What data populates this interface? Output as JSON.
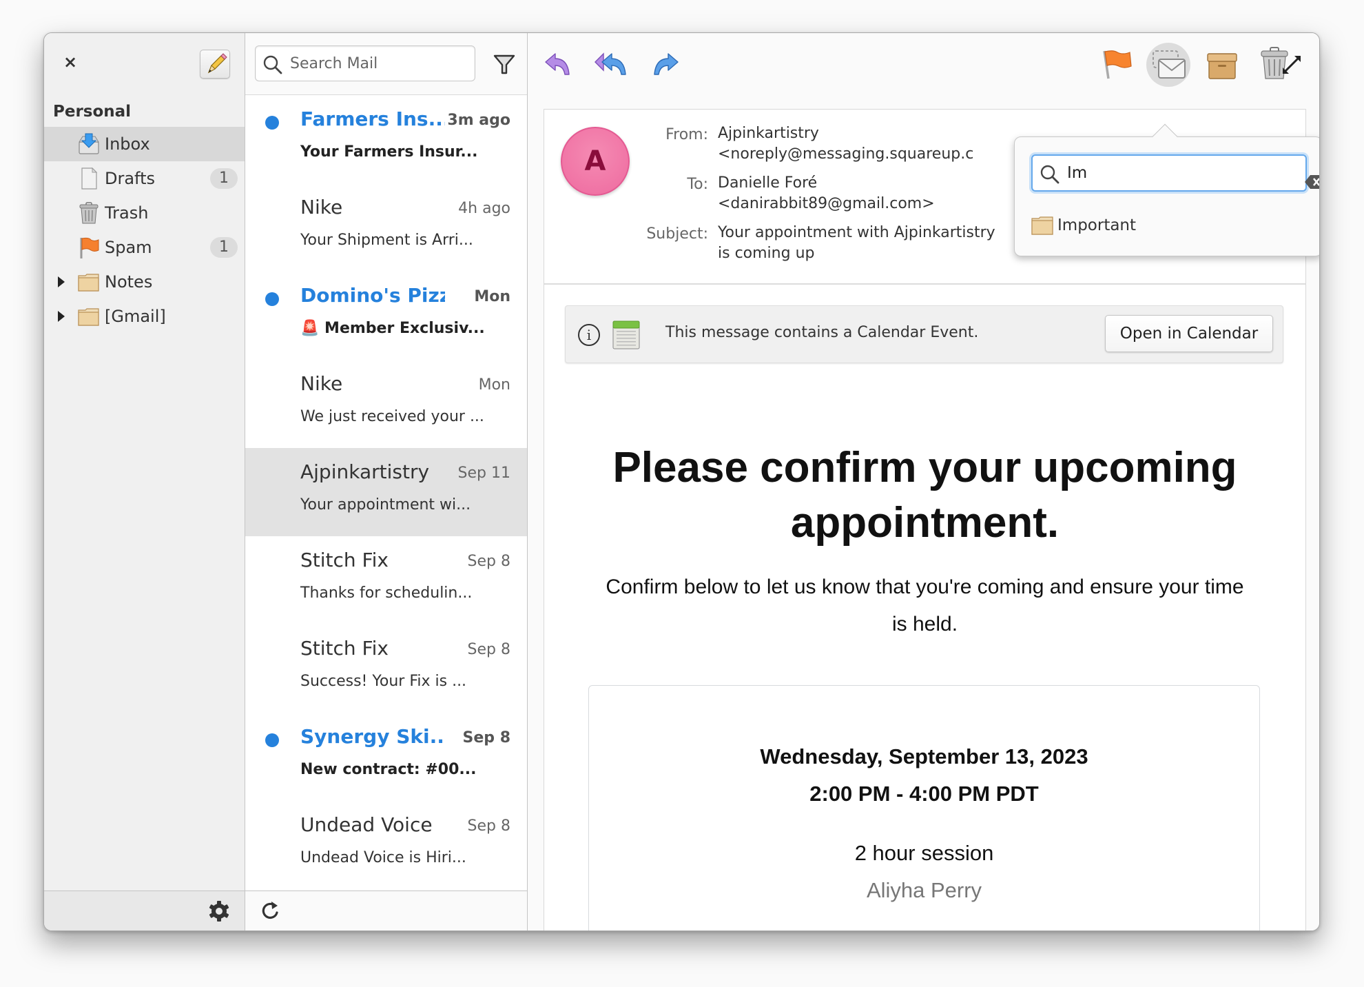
{
  "sidebar": {
    "close_label": "×",
    "account": "Personal",
    "folders": [
      {
        "label": "Inbox",
        "icon": "inbox-icon",
        "badge": null,
        "selected": true,
        "expandable": false
      },
      {
        "label": "Drafts",
        "icon": "drafts-icon",
        "badge": "1",
        "selected": false,
        "expandable": false
      },
      {
        "label": "Trash",
        "icon": "trash-icon",
        "badge": null,
        "selected": false,
        "expandable": false
      },
      {
        "label": "Spam",
        "icon": "flag-icon",
        "badge": "1",
        "selected": false,
        "expandable": false
      },
      {
        "label": "Notes",
        "icon": "folder-icon",
        "badge": null,
        "selected": false,
        "expandable": true
      },
      {
        "label": "[Gmail]",
        "icon": "folder-icon",
        "badge": null,
        "selected": false,
        "expandable": true
      }
    ]
  },
  "message_list": {
    "search_placeholder": "Search Mail",
    "messages": [
      {
        "sender": "Farmers Ins...",
        "date": "3m ago",
        "subject": "Your Farmers Insur...",
        "unread": true,
        "selected": false
      },
      {
        "sender": "Nike",
        "date": "4h ago",
        "subject": "Your Shipment is Arri...",
        "unread": false,
        "selected": false
      },
      {
        "sender": "Domino's Pizza",
        "date": "Mon",
        "subject": "🚨 Member Exclusiv...",
        "unread": true,
        "selected": false
      },
      {
        "sender": "Nike",
        "date": "Mon",
        "subject": "We just received your ...",
        "unread": false,
        "selected": false
      },
      {
        "sender": "Ajpinkartistry",
        "date": "Sep 11",
        "subject": "Your appointment wi...",
        "unread": false,
        "selected": true
      },
      {
        "sender": "Stitch Fix",
        "date": "Sep  8",
        "subject": "Thanks for schedulin...",
        "unread": false,
        "selected": false
      },
      {
        "sender": "Stitch Fix",
        "date": "Sep  8",
        "subject": "Success! Your Fix is ...",
        "unread": false,
        "selected": false
      },
      {
        "sender": "Synergy Ski...",
        "date": "Sep  8",
        "subject": "New contract: #00...",
        "unread": true,
        "selected": false
      },
      {
        "sender": "Undead Voice",
        "date": "Sep  8",
        "subject": "Undead Voice is Hiri...",
        "unread": false,
        "selected": false
      }
    ]
  },
  "message": {
    "avatar_initial": "A",
    "from_label": "From:",
    "from_name": "Ajpinkartistry",
    "from_email": "<noreply@messaging.squareup.c",
    "to_label": "To:",
    "to_name": "Danielle Foré",
    "to_email": "<danirabbit89@gmail.com>",
    "subject_label": "Subject:",
    "subject_line1": "Your appointment with Ajpinkartistry",
    "subject_line2": "is coming up",
    "infobar_text": "This message contains a Calendar Event.",
    "open_calendar_label": "Open in Calendar",
    "body_heading": "Please confirm your upcoming appointment.",
    "body_lead": "Confirm below to let us know that you're coming and ensure your time is held.",
    "appointment": {
      "date": "Wednesday, September 13, 2023",
      "time": "2:00 PM - 4:00 PM PDT",
      "service": "2 hour session",
      "staff": "Aliyha Perry"
    }
  },
  "move_popover": {
    "search_value": "Im",
    "results": [
      "Important"
    ]
  },
  "colors": {
    "accent": "#2581dc",
    "avatar": "#ee6a9f",
    "selected_row": "#e2e2e2"
  }
}
